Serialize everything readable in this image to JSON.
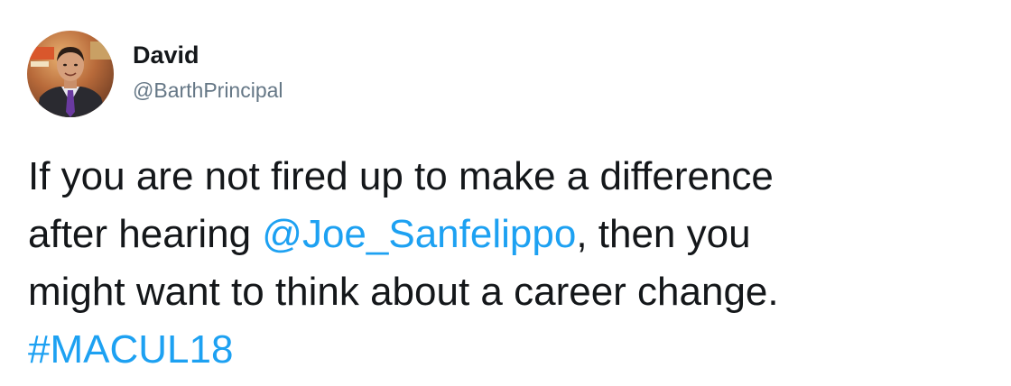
{
  "tweet": {
    "author": {
      "name": "David",
      "handle": "@BarthPrincipal"
    },
    "text": {
      "line1": "If you are not fired up to make a difference",
      "line2_before": "after hearing ",
      "mention": "@Joe_Sanfelippo",
      "line2_after": ", then you",
      "line3": "might want to think about a career change.",
      "hashtag": "#MACUL18"
    }
  },
  "colors": {
    "link": "#1da1f2",
    "text": "#14171a",
    "handle": "#657786"
  },
  "icons": {
    "avatar": "profile-photo"
  }
}
